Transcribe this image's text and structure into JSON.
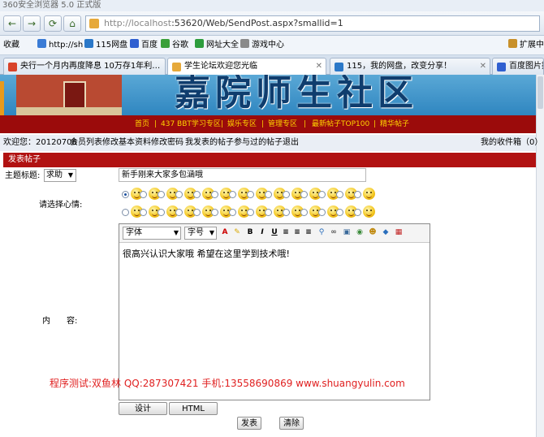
{
  "browser": {
    "window_title": "360安全浏览器 5.0 正式版",
    "url_host": "http://localhost",
    "url_rest": ":53620/Web/SendPost.aspx?smallid=1",
    "nav": {
      "back": "←",
      "forward": "→",
      "refresh": "⟳",
      "home": "⌂"
    },
    "favorites_label": "收藏",
    "favorites": [
      "http://sh",
      "115网盘",
      "百度",
      "谷歌",
      "网址大全",
      "游戏中心"
    ],
    "extend_label": "扩展中",
    "tabs": [
      {
        "label": "央行一个月内再度降息 10万存1年利…"
      },
      {
        "label": "学生论坛欢迎您光临"
      },
      {
        "label": "115，我的网盘，改变分享！"
      },
      {
        "label": "百度图片搜"
      }
    ]
  },
  "banner": {
    "title": "嘉院师生社区"
  },
  "menu": {
    "items": [
      "首页",
      "437 BBT学习专区",
      "娱乐专区",
      "管理专区",
      "最新帖子TOP100",
      "精华帖子"
    ]
  },
  "welcome": {
    "greeting": "欢迎您：",
    "user": "20120706",
    "links": [
      "会员列表",
      "修改基本资料",
      "修改密码",
      "我发表的帖子",
      "参与过的帖子",
      "退出"
    ],
    "inbox": "我的收件箱（0）"
  },
  "section": {
    "title": "发表帖子"
  },
  "form": {
    "subject_label": "主题标题:",
    "subject_type": "求助",
    "subject_value": "新手刚来大家多包涵哦",
    "mood_label": "请选择心情:",
    "content_label": "内　　容:",
    "editor": {
      "font_select": "字体",
      "size_select": "字号",
      "body": "很高兴认识大家哦 希望在这里学到技术哦!"
    },
    "promo": "程序测试:双鱼林 QQ:287307421 手机:13558690869 www.shuangyulin.com",
    "mode_buttons": [
      "设计",
      "HTML"
    ],
    "submit_label": "发表",
    "clear_label": "清除"
  },
  "colors": {
    "menu_bg": "#9b0b0b",
    "menu_text": "#ffd400",
    "section_bg": "#b11212",
    "promo": "#e02020"
  }
}
